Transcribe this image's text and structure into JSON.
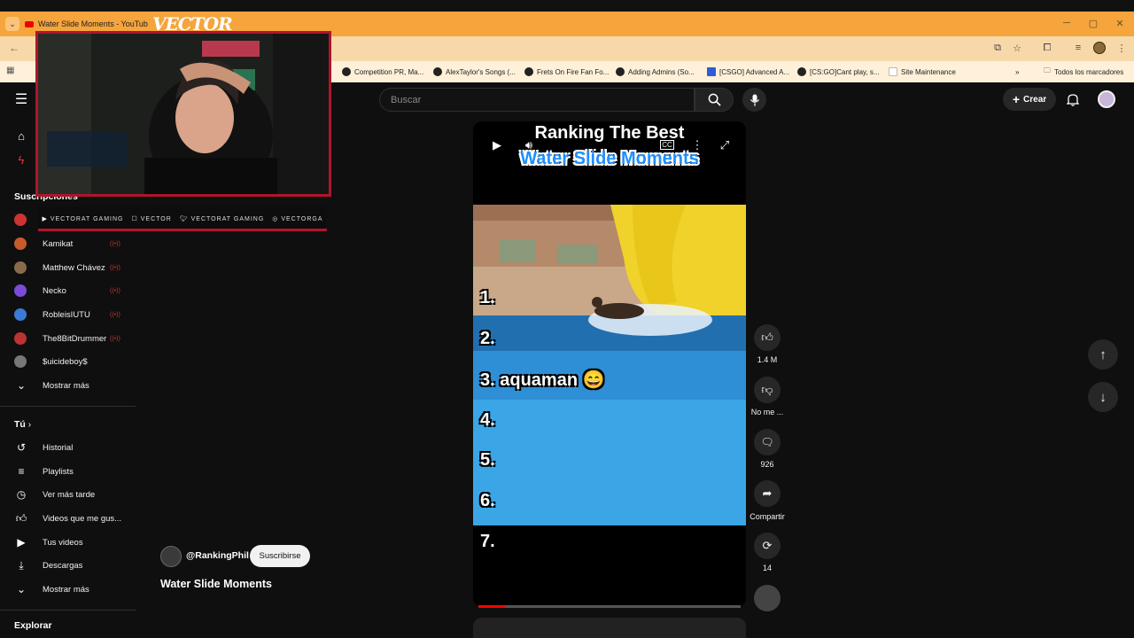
{
  "browser": {
    "tab_title": "Water Slide Moments - YouTub",
    "bookmarks": [
      {
        "label": "Competition PR, Ma...",
        "icon": "github-icon"
      },
      {
        "label": "AlexTaylor's Songs (...",
        "icon": "github-icon"
      },
      {
        "label": "Frets On Fire Fan Fo...",
        "icon": "github-icon"
      },
      {
        "label": "Adding Admins (So...",
        "icon": "github-icon"
      },
      {
        "label": "[CSGO] Advanced A...",
        "icon": "alliedmods-icon"
      },
      {
        "label": "[CS:GO]Cant play, s...",
        "icon": "github-icon"
      },
      {
        "label": "Site Maintenance",
        "icon": "page-icon"
      }
    ],
    "all_bookmarks": "Todos los marcadores"
  },
  "overlay": {
    "logo": "VECTOR",
    "social": [
      "VECTORAT GAMING",
      "VECTOR",
      "VECTORAT GAMING",
      "VECTORGA"
    ]
  },
  "header": {
    "search_placeholder": "Buscar",
    "create_label": "Crear"
  },
  "sidebar": {
    "subscriptions_title": "Suscripciones",
    "channels": [
      {
        "name": "Kamikat",
        "live": true,
        "color": "#c75b2a"
      },
      {
        "name": "Matthew Chávez",
        "live": true,
        "color": "#8a6a4a"
      },
      {
        "name": "Necko",
        "live": true,
        "color": "#7b4bd6"
      },
      {
        "name": "RobleisIUTU",
        "live": true,
        "color": "#3c7ad6"
      },
      {
        "name": "The8BitDrummer",
        "live": true,
        "color": "#b33"
      },
      {
        "name": "$uicideboy$",
        "live": false,
        "color": "#777"
      }
    ],
    "show_more": "Mostrar más",
    "you_title": "Tú",
    "you_items": [
      {
        "label": "Historial",
        "icon": "history-icon"
      },
      {
        "label": "Playlists",
        "icon": "playlist-icon"
      },
      {
        "label": "Ver más tarde",
        "icon": "clock-icon"
      },
      {
        "label": "Videos que me gus...",
        "icon": "thumbs-up-icon"
      },
      {
        "label": "Tus videos",
        "icon": "video-icon"
      },
      {
        "label": "Descargas",
        "icon": "download-icon"
      }
    ],
    "show_more_2": "Mostrar más",
    "explore_title": "Explorar"
  },
  "short": {
    "title_line1": "Ranking The Best",
    "title_line2": "Water Slide Moments",
    "ranks": [
      "1.",
      "2.",
      "3. aquaman 😄",
      "4.",
      "5.",
      "6.",
      "7."
    ],
    "progress": 0.1,
    "channel_handle": "@RankingPhil",
    "subscribe_label": "Suscribirse",
    "video_title": "Water Slide Moments"
  },
  "actions": {
    "likes": "1.4 M",
    "dislike": "No me ...",
    "comments": "926",
    "share": "Compartir",
    "remix": "14"
  }
}
